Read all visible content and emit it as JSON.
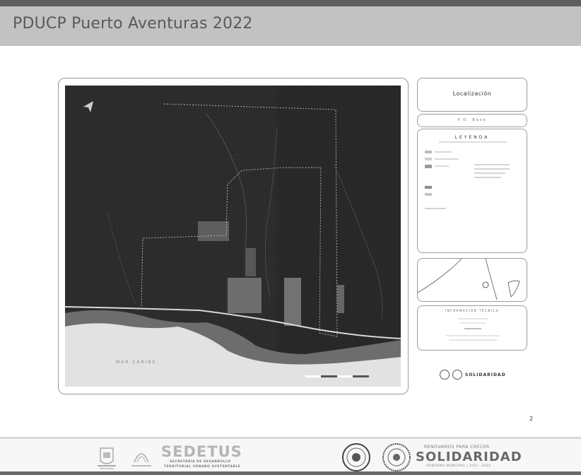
{
  "header": {
    "title": "PDUCP Puerto Aventuras 2022"
  },
  "map_panel": {
    "sea_label": "MAR CARIBE"
  },
  "sidebar": {
    "title": "Localización",
    "subtitle": "P.D. Base",
    "legend_title": "LEYENDA",
    "info_title": "INFORMACIÓN TÉCNICA",
    "brand": "SOLIDARIDAD"
  },
  "page": {
    "number": "2"
  },
  "footer": {
    "sedetus_title": "SEDETUS",
    "sedetus_line1": "SECRETARÍA DE DESARROLLO",
    "sedetus_line2": "TERRITORIAL URBANO SUSTENTABLE",
    "sol_tagline": "RENOVAMOS PARA CRECER",
    "sol_title": "SOLIDARIDAD",
    "sol_footer": "GOBIERNO MUNICIPAL | 2021 - 2024"
  },
  "colors": {
    "header_bg": "#c2c2c2",
    "map_dark": "#2b2b2b",
    "beach": "#e4e4e4"
  }
}
